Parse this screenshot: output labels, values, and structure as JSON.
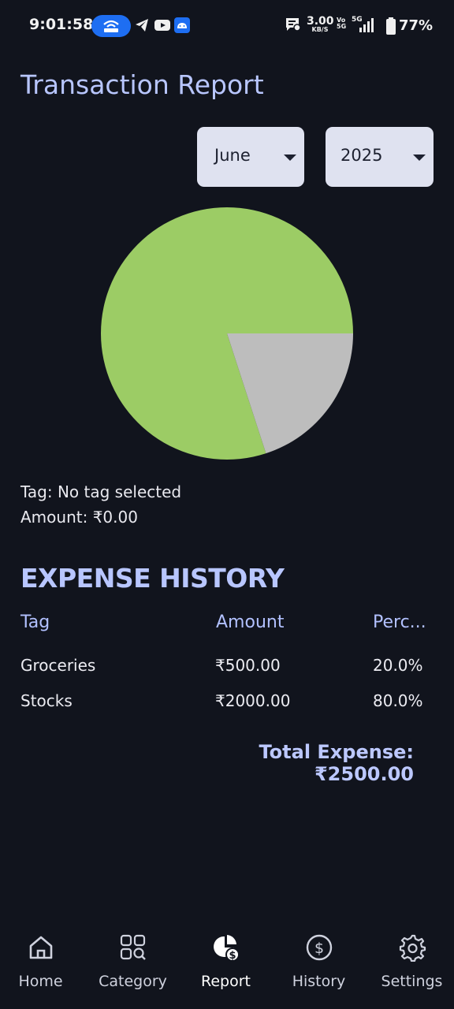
{
  "status_bar": {
    "time": "9:01:58",
    "net_speed_value": "3.00",
    "net_speed_unit": "KB/S",
    "volte_top": "Vo",
    "volte_bottom": "5G",
    "network": "5G",
    "battery": "77%"
  },
  "page": {
    "title": "Transaction Report"
  },
  "filters": {
    "month": "June",
    "year": "2025"
  },
  "chart_data": {
    "type": "pie",
    "slices": [
      {
        "label": "Stocks",
        "value": 2000,
        "percent": 80.0,
        "color": "#9ccc65"
      },
      {
        "label": "Groceries",
        "value": 500,
        "percent": 20.0,
        "color": "#bdbdbd"
      }
    ]
  },
  "selection": {
    "tag": "Tag: No tag selected",
    "amount": "Amount: ₹0.00"
  },
  "expense_history": {
    "title": "EXPENSE HISTORY",
    "headers": [
      "Tag",
      "Amount",
      "Perc..."
    ],
    "rows": [
      [
        "Groceries",
        "₹500.00",
        "20.0%"
      ],
      [
        "Stocks",
        "₹2000.00",
        "80.0%"
      ]
    ],
    "total": "Total Expense: ₹2500.00"
  },
  "nav": [
    {
      "label": "Home",
      "icon": "home-icon"
    },
    {
      "label": "Category",
      "icon": "category-search-icon"
    },
    {
      "label": "Report",
      "icon": "report-pie-dollar-icon",
      "active": true
    },
    {
      "label": "History",
      "icon": "dollar-circle-icon"
    },
    {
      "label": "Settings",
      "icon": "gear-icon"
    }
  ],
  "colors": {
    "accent": "#b8c6ff",
    "background": "#11141d",
    "dropdown": "#dfe2f0"
  }
}
